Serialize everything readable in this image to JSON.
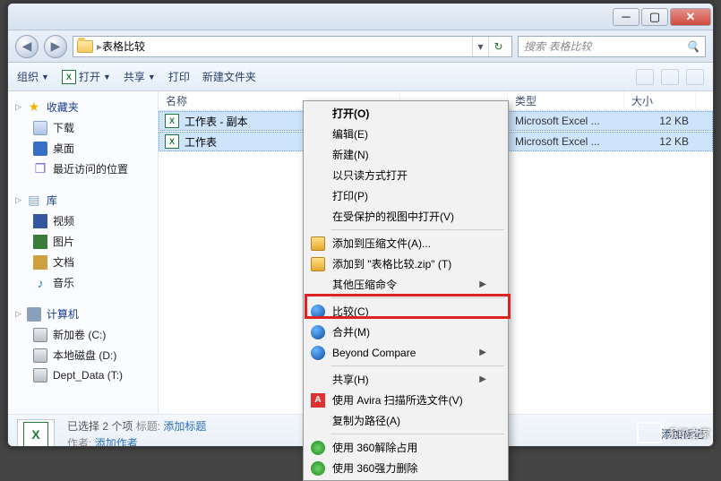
{
  "path_label": "表格比较",
  "search_placeholder": "搜索 表格比较",
  "toolbar": {
    "organize": "组织",
    "open": "打开",
    "share": "共享",
    "print": "打印",
    "new_folder": "新建文件夹"
  },
  "columns": {
    "name": "名称",
    "modified": "",
    "type": "类型",
    "size": "大小"
  },
  "files": [
    {
      "name": "工作表 - 副本",
      "type": "Microsoft Excel ...",
      "size": "12 KB"
    },
    {
      "name": "工作表",
      "type": "Microsoft Excel ...",
      "size": "12 KB"
    }
  ],
  "sidebar": {
    "favorites": {
      "label": "收藏夹",
      "items": [
        "下载",
        "桌面",
        "最近访问的位置"
      ]
    },
    "libraries": {
      "label": "库",
      "items": [
        "视频",
        "图片",
        "文档",
        "音乐"
      ]
    },
    "computer": {
      "label": "计算机",
      "items": [
        "新加卷 (C:)",
        "本地磁盘 (D:)",
        "Dept_Data (T:)"
      ]
    }
  },
  "status": {
    "selection": "已选择 2 个项",
    "title_label": "标题:",
    "title_value": "添加标题",
    "author_label": "作者:",
    "author_value": "添加作者",
    "tag_link": "添加标记"
  },
  "context_menu": {
    "open": "打开(O)",
    "edit": "编辑(E)",
    "new": "新建(N)",
    "readonly": "以只读方式打开",
    "print": "打印(P)",
    "protected": "在受保护的视图中打开(V)",
    "addzip": "添加到压缩文件(A)...",
    "addzip_named": "添加到 \"表格比较.zip\" (T)",
    "other_zip": "其他压缩命令",
    "compare": "比较(C)",
    "merge": "合并(M)",
    "beyond": "Beyond Compare",
    "share": "共享(H)",
    "avira": "使用 Avira 扫描所选文件(V)",
    "copypath": "复制为路径(A)",
    "unlock360": "使用 360解除占用",
    "force360": "使用 360强力删除"
  },
  "watermark": "系统之家"
}
